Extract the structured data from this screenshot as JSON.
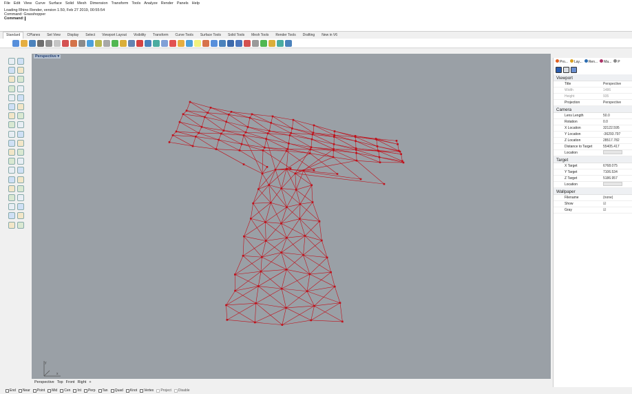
{
  "menu": [
    "File",
    "Edit",
    "View",
    "Curve",
    "Surface",
    "Solid",
    "Mesh",
    "Dimension",
    "Transform",
    "Tools",
    "Analyze",
    "Render",
    "Panels",
    "Help"
  ],
  "command_history": {
    "line1": "Loading Rhino Render, version 1.50, Feb 27 2019, 00:55:54",
    "line2": "Command: Grasshopper",
    "prompt": "Command:"
  },
  "toolbar_tabs": [
    "Standard",
    "CPlanes",
    "Set View",
    "Display",
    "Select",
    "Viewport Layout",
    "Visibility",
    "Transform",
    "Curve Tools",
    "Surface Tools",
    "Solid Tools",
    "Mesh Tools",
    "Render Tools",
    "Drafting",
    "New in V6"
  ],
  "viewport": {
    "label": "Perspective",
    "axis_y": "y",
    "axis_x": "x",
    "background": "#9aa0a6",
    "mesh_color": "#c0101a"
  },
  "viewport_tabs": [
    "Perspective",
    "Top",
    "Front",
    "Right",
    "+"
  ],
  "osnaps": [
    "End",
    "Near",
    "Point",
    "Mid",
    "Cen",
    "Int",
    "Perp",
    "Tan",
    "Quad",
    "Knot",
    "Vertex"
  ],
  "osnap_extra": [
    "Project",
    "Disable"
  ],
  "panel": {
    "tabs": [
      "Pro...",
      "Lay...",
      "Ren...",
      "Ma...",
      "P"
    ],
    "viewport_section": "Viewport",
    "viewport_rows": [
      {
        "k": "Title",
        "v": "Perspective",
        "dim": false
      },
      {
        "k": "Width",
        "v": "1486",
        "dim": true
      },
      {
        "k": "Height",
        "v": "935",
        "dim": true
      },
      {
        "k": "Projection",
        "v": "Perspective",
        "dim": false
      }
    ],
    "camera_section": "Camera",
    "camera_rows": [
      {
        "k": "Lens Length",
        "v": "50.0"
      },
      {
        "k": "Rotation",
        "v": "0.0"
      },
      {
        "k": "X Location",
        "v": "32122.595"
      },
      {
        "k": "Y Location",
        "v": "-36293.797"
      },
      {
        "k": "Z Location",
        "v": "28517.782"
      },
      {
        "k": "Distance to Target",
        "v": "55405.417"
      },
      {
        "k": "Location",
        "v": ""
      }
    ],
    "target_section": "Target",
    "target_rows": [
      {
        "k": "X Target",
        "v": "6768.075"
      },
      {
        "k": "Y Target",
        "v": "7106.534"
      },
      {
        "k": "Z Target",
        "v": "5186.957"
      },
      {
        "k": "Location",
        "v": ""
      }
    ],
    "wallpaper_section": "Wallpaper",
    "wallpaper_rows": [
      {
        "k": "Filename",
        "v": "(none)"
      },
      {
        "k": "Show",
        "v": "☑"
      },
      {
        "k": "Gray",
        "v": "☑"
      }
    ]
  }
}
